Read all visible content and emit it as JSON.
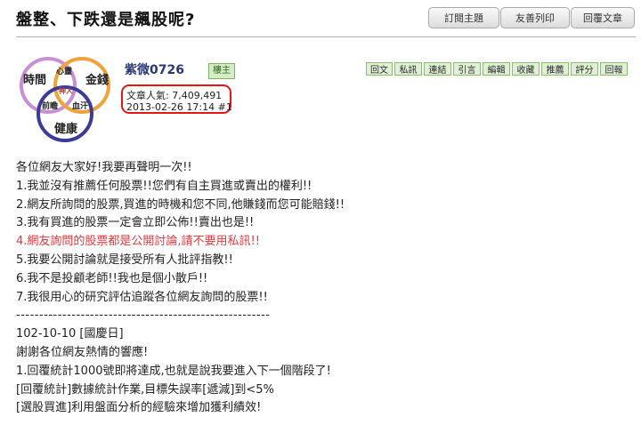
{
  "thread": {
    "title": "盤整、下跌還是飆股呢?"
  },
  "top_buttons": {
    "subscribe": "訂閱主題",
    "print": "友善列印",
    "reply": "回覆文章"
  },
  "logo": {
    "labels": [
      "時間",
      "金錢",
      "健康",
      "心靈",
      "神人",
      "前瞻",
      "血汗"
    ],
    "circle_colors": [
      "#c98fd4",
      "#f0a33a",
      "#3d3b9a"
    ]
  },
  "author": {
    "name": "紫微0726",
    "badge": "樓主"
  },
  "stats": {
    "popularity": "文章人氣: 7,409,491",
    "posted": "2013-02-26 17:14  #1"
  },
  "actions": [
    "回文",
    "私訊",
    "連結",
    "引言",
    "編輯",
    "收藏",
    "推薦",
    "評分",
    "回報"
  ],
  "post_lines": [
    "各位網友大家好!我要再聲明一次!!",
    "1.我並沒有推薦任何股票!!您們有自主買進或賣出的權利!!",
    "2.網友所詢問的股票,買進的時機和您不同,他賺錢而您可能賠錢!!",
    "3.我有買進的股票一定會立即公佈!!賣出也是!!",
    "4.網友詢問的股票都是公開討論,請不要用私訊!!",
    "5.我要公開討論就是接受所有人批評指教!!",
    "6.我不是投顧老師!!我也是個小散戶!!",
    "7.我很用心的研究評估追蹤各位網友詢問的股票!!",
    "-------------------------------------------------------",
    "102-10-10 [國慶日]",
    "謝謝各位網友熱情的響應!",
    "1.回覆統計1000號即將達成,也就是說我要進入下一個階段了!",
    "[回覆統計]數據統計作業,目標失誤率[遞減]到<5%",
    "[選股買進]利用盤面分析的經驗來增加獲利績效!"
  ],
  "highlight_color": "#e8383d"
}
